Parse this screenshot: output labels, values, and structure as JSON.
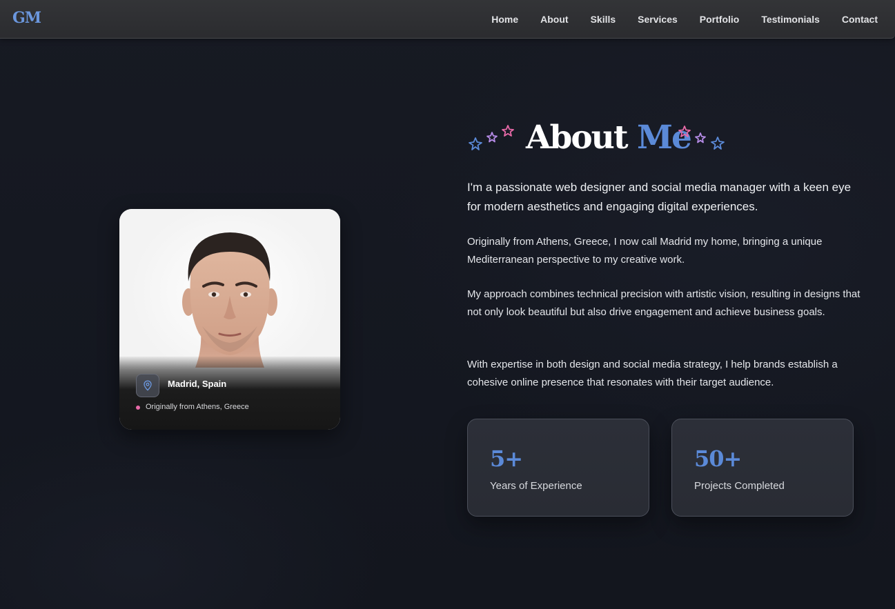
{
  "nav": {
    "logo": "GM",
    "links": [
      "Home",
      "About",
      "Skills",
      "Services",
      "Portfolio",
      "Testimonials",
      "Contact"
    ]
  },
  "profile": {
    "location": "Madrid, Spain",
    "origin": "Originally from Athens, Greece",
    "icon": "map-pin-icon"
  },
  "about": {
    "title_part1": "About",
    "title_part2": "Me",
    "lead": "I'm a passionate web designer and social media manager with a keen eye for modern aesthetics and engaging digital experiences.",
    "paragraphs": [
      "Originally from Athens, Greece, I now call Madrid my home, bringing a unique Mediterranean perspective to my creative work.",
      "My approach combines technical precision with artistic vision, resulting in designs that not only look beautiful but also drive engagement and achieve business goals.",
      "With expertise in both design and social media strategy, I help brands establish a cohesive online presence that resonates with their target audience."
    ]
  },
  "stats": [
    {
      "value": "5+",
      "label": "Years of Experience"
    },
    {
      "value": "50+",
      "label": "Projects Completed"
    }
  ],
  "colors": {
    "accent_blue": "#5b8ad8",
    "accent_pink": "#e86aa8",
    "accent_purple": "#b58be6",
    "background": "#141720"
  }
}
